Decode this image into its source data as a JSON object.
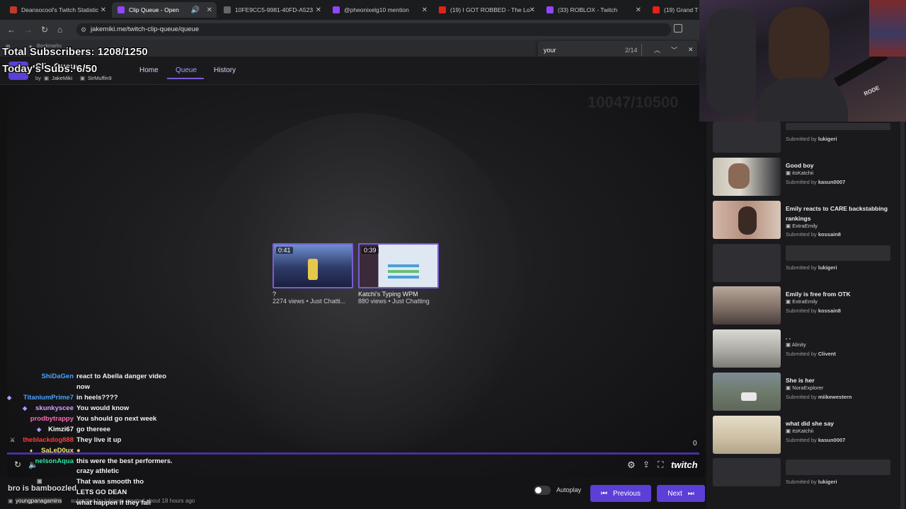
{
  "browser": {
    "tabs": [
      {
        "label": "Deansocool's Twitch Statistic",
        "color": "#c0392b"
      },
      {
        "label": "Clip Queue - Open",
        "color": "#9146ff"
      },
      {
        "label": "10FE9CC5-9981-40FD-A523",
        "color": "#666666"
      },
      {
        "label": "@pheonixelg10 mention",
        "color": "#9146ff"
      },
      {
        "label": "(19) I GOT ROBBED - The Lo",
        "color": "#e62117"
      },
      {
        "label": "(33) ROBLOX - Twitch",
        "color": "#9146ff"
      },
      {
        "label": "(19) Grand T",
        "color": "#e62117"
      }
    ],
    "url": "jakemiki.me/twitch-clip-queue/queue",
    "bookmarks_label": "Bookmarks",
    "find": {
      "query": "your",
      "count": "2/14"
    }
  },
  "overlay": {
    "total_subs": "Total Subscribers: 1208/1250",
    "today_subs": "Today's Subs: 6/50",
    "bottom_text": "bro is bamboozled",
    "faint_text": "10047/10500"
  },
  "app": {
    "title": "Clip Queue",
    "by": "by",
    "author1": "JakeMiki",
    "author2": "SirMuffin9",
    "nav": [
      "Home",
      "Queue",
      "History"
    ],
    "active_nav": "Queue"
  },
  "clips": [
    {
      "duration": "0:41",
      "title": "?",
      "meta": "2274 views • Just Chatti..."
    },
    {
      "duration": "0:39",
      "title": "Katchi's Typing WPM",
      "meta": "880 views • Just Chatting"
    }
  ],
  "chat": [
    {
      "user": "ShiDaGen",
      "msg": "react to Abella danger video",
      "color": "#4aa3ff"
    },
    {
      "user": "",
      "msg": "now",
      "color": "#ffffff"
    },
    {
      "user": "TitaniumPrime7",
      "msg": "in heels????",
      "color": "#4aa3ff"
    },
    {
      "user": "skunkyscee",
      "msg": "You would know",
      "color": "#d6a0ff"
    },
    {
      "user": "prodbytrappy",
      "msg": "You should go next week",
      "color": "#ff69b4"
    },
    {
      "user": "Kimzi67",
      "msg": "go thereee",
      "color": "#ffffff"
    },
    {
      "user": "theblackdog888",
      "msg": "They live it up",
      "color": "#ff3b3b"
    },
    {
      "user": "SaLeD0ux",
      "msg": "",
      "color": "#f5e663"
    },
    {
      "user": "nelsonAqua",
      "msg": "this were the best performers.",
      "color": "#2ee6a8"
    },
    {
      "user": "",
      "msg": "crazy athletic",
      "color": "#ffffff"
    },
    {
      "user": "",
      "msg": "That was smooth tho",
      "color": "#ffffff"
    },
    {
      "user": "",
      "msg": "LETS GO DEAN",
      "color": "#ffffff"
    },
    {
      "user": "",
      "msg": "what happen if they fall",
      "color": "#ffffff"
    }
  ],
  "player": {
    "counter": "0",
    "current_clip_meta": "submitted by lukigeri, created about 18 hours ago",
    "submitter_prefix": "youngpanagamins"
  },
  "controls": {
    "autoplay": "Autoplay",
    "previous": "Previous",
    "next": "Next",
    "brand": "twitch"
  },
  "sidebar": [
    {
      "title": "",
      "channel": "",
      "submitted_label": "Submitted by",
      "submitter": "lukigeri",
      "placeholder": true
    },
    {
      "title": "Good boy",
      "channel": "itsKatchii",
      "submitted_label": "Submitted by",
      "submitter": "kasun0007",
      "placeholder": false
    },
    {
      "title": "Emily reacts to CARE backstabbing rankings",
      "channel": "ExtraEmily",
      "submitted_label": "Submitted by",
      "submitter": "kossain8",
      "placeholder": false
    },
    {
      "title": "",
      "channel": "",
      "submitted_label": "Submitted by",
      "submitter": "lukigeri",
      "placeholder": true
    },
    {
      "title": "Emily is free from OTK",
      "channel": "ExtraEmily",
      "submitted_label": "Submitted by",
      "submitter": "kossain8",
      "placeholder": false
    },
    {
      "title": ". .",
      "channel": "Alinity",
      "submitted_label": "Submitted by",
      "submitter": "Clivent",
      "placeholder": false
    },
    {
      "title": "She is her",
      "channel": "NoraExplorer",
      "submitted_label": "Submitted by",
      "submitter": "miikewestern",
      "placeholder": false
    },
    {
      "title": "what did she say",
      "channel": "itsKatchii",
      "submitted_label": "Submitted by",
      "submitter": "kasun0007",
      "placeholder": false
    },
    {
      "title": "",
      "channel": "",
      "submitted_label": "Submitted by",
      "submitter": "lukigeri",
      "placeholder": true
    }
  ],
  "webcam": {
    "mic_brand": "RODE"
  }
}
